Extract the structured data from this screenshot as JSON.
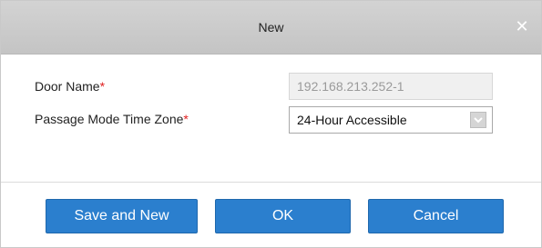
{
  "dialog": {
    "title": "New",
    "close_icon": "close-icon"
  },
  "form": {
    "door_name": {
      "label": "Door Name",
      "required_mark": "*",
      "value": "192.168.213.252-1"
    },
    "passage_mode_time_zone": {
      "label": "Passage Mode Time Zone",
      "required_mark": "*",
      "value": "24-Hour Accessible",
      "icon": "chevron-down-icon"
    }
  },
  "buttons": {
    "save_and_new": "Save and New",
    "ok": "OK",
    "cancel": "Cancel"
  },
  "colors": {
    "button_blue": "#2b7fce",
    "required_red": "#e02020",
    "titlebar_gray": "#cdcdcd"
  }
}
